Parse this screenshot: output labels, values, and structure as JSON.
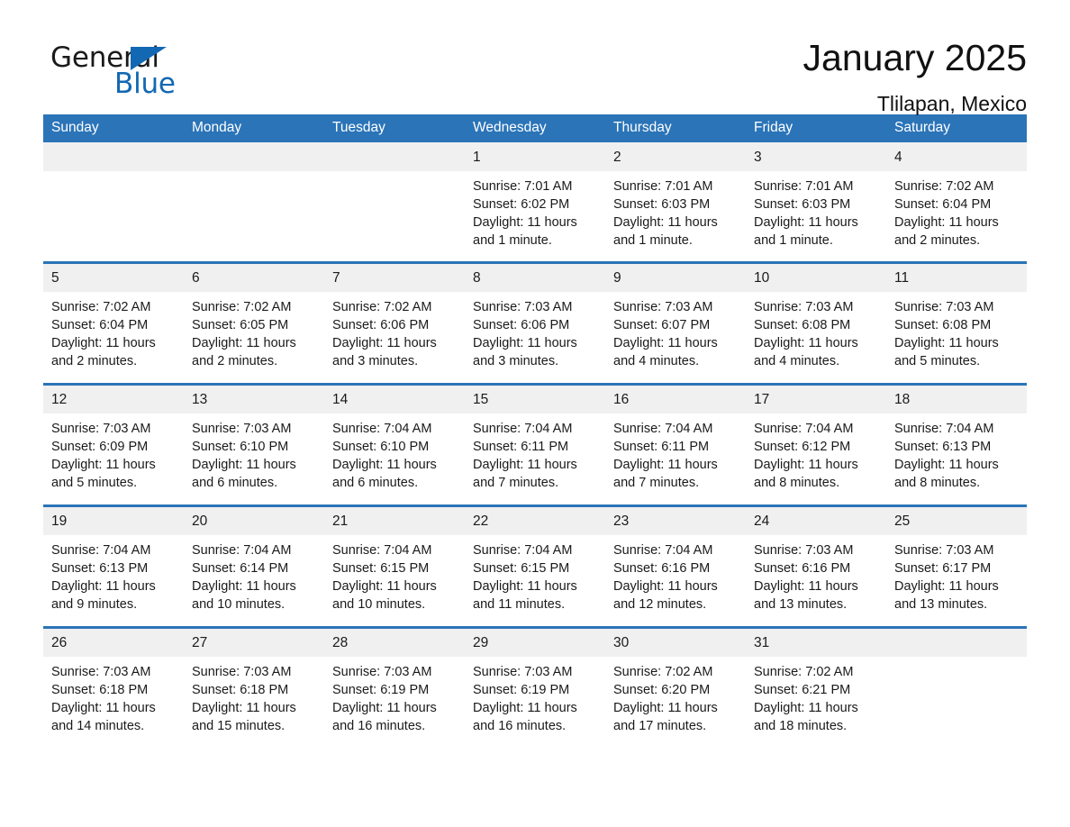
{
  "logo": {
    "word_general": "General",
    "word_blue": "Blue",
    "triangle_color": "#1268b3"
  },
  "header": {
    "month_title": "January 2025",
    "location": "Tlilapan, Mexico"
  },
  "theme": {
    "header_blue": "#2b74b8",
    "daynum_band": "#f0f0f0",
    "page_background": "#ffffff",
    "text": "#1a1a1a"
  },
  "calendar": {
    "weekday_headers": [
      "Sunday",
      "Monday",
      "Tuesday",
      "Wednesday",
      "Thursday",
      "Friday",
      "Saturday"
    ],
    "weeks": [
      [
        {
          "day": "",
          "sunrise": "",
          "sunset": "",
          "daylight_line1": "",
          "daylight_line2": ""
        },
        {
          "day": "",
          "sunrise": "",
          "sunset": "",
          "daylight_line1": "",
          "daylight_line2": ""
        },
        {
          "day": "",
          "sunrise": "",
          "sunset": "",
          "daylight_line1": "",
          "daylight_line2": ""
        },
        {
          "day": "1",
          "sunrise": "Sunrise: 7:01 AM",
          "sunset": "Sunset: 6:02 PM",
          "daylight_line1": "Daylight: 11 hours",
          "daylight_line2": "and 1 minute."
        },
        {
          "day": "2",
          "sunrise": "Sunrise: 7:01 AM",
          "sunset": "Sunset: 6:03 PM",
          "daylight_line1": "Daylight: 11 hours",
          "daylight_line2": "and 1 minute."
        },
        {
          "day": "3",
          "sunrise": "Sunrise: 7:01 AM",
          "sunset": "Sunset: 6:03 PM",
          "daylight_line1": "Daylight: 11 hours",
          "daylight_line2": "and 1 minute."
        },
        {
          "day": "4",
          "sunrise": "Sunrise: 7:02 AM",
          "sunset": "Sunset: 6:04 PM",
          "daylight_line1": "Daylight: 11 hours",
          "daylight_line2": "and 2 minutes."
        }
      ],
      [
        {
          "day": "5",
          "sunrise": "Sunrise: 7:02 AM",
          "sunset": "Sunset: 6:04 PM",
          "daylight_line1": "Daylight: 11 hours",
          "daylight_line2": "and 2 minutes."
        },
        {
          "day": "6",
          "sunrise": "Sunrise: 7:02 AM",
          "sunset": "Sunset: 6:05 PM",
          "daylight_line1": "Daylight: 11 hours",
          "daylight_line2": "and 2 minutes."
        },
        {
          "day": "7",
          "sunrise": "Sunrise: 7:02 AM",
          "sunset": "Sunset: 6:06 PM",
          "daylight_line1": "Daylight: 11 hours",
          "daylight_line2": "and 3 minutes."
        },
        {
          "day": "8",
          "sunrise": "Sunrise: 7:03 AM",
          "sunset": "Sunset: 6:06 PM",
          "daylight_line1": "Daylight: 11 hours",
          "daylight_line2": "and 3 minutes."
        },
        {
          "day": "9",
          "sunrise": "Sunrise: 7:03 AM",
          "sunset": "Sunset: 6:07 PM",
          "daylight_line1": "Daylight: 11 hours",
          "daylight_line2": "and 4 minutes."
        },
        {
          "day": "10",
          "sunrise": "Sunrise: 7:03 AM",
          "sunset": "Sunset: 6:08 PM",
          "daylight_line1": "Daylight: 11 hours",
          "daylight_line2": "and 4 minutes."
        },
        {
          "day": "11",
          "sunrise": "Sunrise: 7:03 AM",
          "sunset": "Sunset: 6:08 PM",
          "daylight_line1": "Daylight: 11 hours",
          "daylight_line2": "and 5 minutes."
        }
      ],
      [
        {
          "day": "12",
          "sunrise": "Sunrise: 7:03 AM",
          "sunset": "Sunset: 6:09 PM",
          "daylight_line1": "Daylight: 11 hours",
          "daylight_line2": "and 5 minutes."
        },
        {
          "day": "13",
          "sunrise": "Sunrise: 7:03 AM",
          "sunset": "Sunset: 6:10 PM",
          "daylight_line1": "Daylight: 11 hours",
          "daylight_line2": "and 6 minutes."
        },
        {
          "day": "14",
          "sunrise": "Sunrise: 7:04 AM",
          "sunset": "Sunset: 6:10 PM",
          "daylight_line1": "Daylight: 11 hours",
          "daylight_line2": "and 6 minutes."
        },
        {
          "day": "15",
          "sunrise": "Sunrise: 7:04 AM",
          "sunset": "Sunset: 6:11 PM",
          "daylight_line1": "Daylight: 11 hours",
          "daylight_line2": "and 7 minutes."
        },
        {
          "day": "16",
          "sunrise": "Sunrise: 7:04 AM",
          "sunset": "Sunset: 6:11 PM",
          "daylight_line1": "Daylight: 11 hours",
          "daylight_line2": "and 7 minutes."
        },
        {
          "day": "17",
          "sunrise": "Sunrise: 7:04 AM",
          "sunset": "Sunset: 6:12 PM",
          "daylight_line1": "Daylight: 11 hours",
          "daylight_line2": "and 8 minutes."
        },
        {
          "day": "18",
          "sunrise": "Sunrise: 7:04 AM",
          "sunset": "Sunset: 6:13 PM",
          "daylight_line1": "Daylight: 11 hours",
          "daylight_line2": "and 8 minutes."
        }
      ],
      [
        {
          "day": "19",
          "sunrise": "Sunrise: 7:04 AM",
          "sunset": "Sunset: 6:13 PM",
          "daylight_line1": "Daylight: 11 hours",
          "daylight_line2": "and 9 minutes."
        },
        {
          "day": "20",
          "sunrise": "Sunrise: 7:04 AM",
          "sunset": "Sunset: 6:14 PM",
          "daylight_line1": "Daylight: 11 hours",
          "daylight_line2": "and 10 minutes."
        },
        {
          "day": "21",
          "sunrise": "Sunrise: 7:04 AM",
          "sunset": "Sunset: 6:15 PM",
          "daylight_line1": "Daylight: 11 hours",
          "daylight_line2": "and 10 minutes."
        },
        {
          "day": "22",
          "sunrise": "Sunrise: 7:04 AM",
          "sunset": "Sunset: 6:15 PM",
          "daylight_line1": "Daylight: 11 hours",
          "daylight_line2": "and 11 minutes."
        },
        {
          "day": "23",
          "sunrise": "Sunrise: 7:04 AM",
          "sunset": "Sunset: 6:16 PM",
          "daylight_line1": "Daylight: 11 hours",
          "daylight_line2": "and 12 minutes."
        },
        {
          "day": "24",
          "sunrise": "Sunrise: 7:03 AM",
          "sunset": "Sunset: 6:16 PM",
          "daylight_line1": "Daylight: 11 hours",
          "daylight_line2": "and 13 minutes."
        },
        {
          "day": "25",
          "sunrise": "Sunrise: 7:03 AM",
          "sunset": "Sunset: 6:17 PM",
          "daylight_line1": "Daylight: 11 hours",
          "daylight_line2": "and 13 minutes."
        }
      ],
      [
        {
          "day": "26",
          "sunrise": "Sunrise: 7:03 AM",
          "sunset": "Sunset: 6:18 PM",
          "daylight_line1": "Daylight: 11 hours",
          "daylight_line2": "and 14 minutes."
        },
        {
          "day": "27",
          "sunrise": "Sunrise: 7:03 AM",
          "sunset": "Sunset: 6:18 PM",
          "daylight_line1": "Daylight: 11 hours",
          "daylight_line2": "and 15 minutes."
        },
        {
          "day": "28",
          "sunrise": "Sunrise: 7:03 AM",
          "sunset": "Sunset: 6:19 PM",
          "daylight_line1": "Daylight: 11 hours",
          "daylight_line2": "and 16 minutes."
        },
        {
          "day": "29",
          "sunrise": "Sunrise: 7:03 AM",
          "sunset": "Sunset: 6:19 PM",
          "daylight_line1": "Daylight: 11 hours",
          "daylight_line2": "and 16 minutes."
        },
        {
          "day": "30",
          "sunrise": "Sunrise: 7:02 AM",
          "sunset": "Sunset: 6:20 PM",
          "daylight_line1": "Daylight: 11 hours",
          "daylight_line2": "and 17 minutes."
        },
        {
          "day": "31",
          "sunrise": "Sunrise: 7:02 AM",
          "sunset": "Sunset: 6:21 PM",
          "daylight_line1": "Daylight: 11 hours",
          "daylight_line2": "and 18 minutes."
        },
        {
          "day": "",
          "sunrise": "",
          "sunset": "",
          "daylight_line1": "",
          "daylight_line2": ""
        }
      ]
    ]
  }
}
